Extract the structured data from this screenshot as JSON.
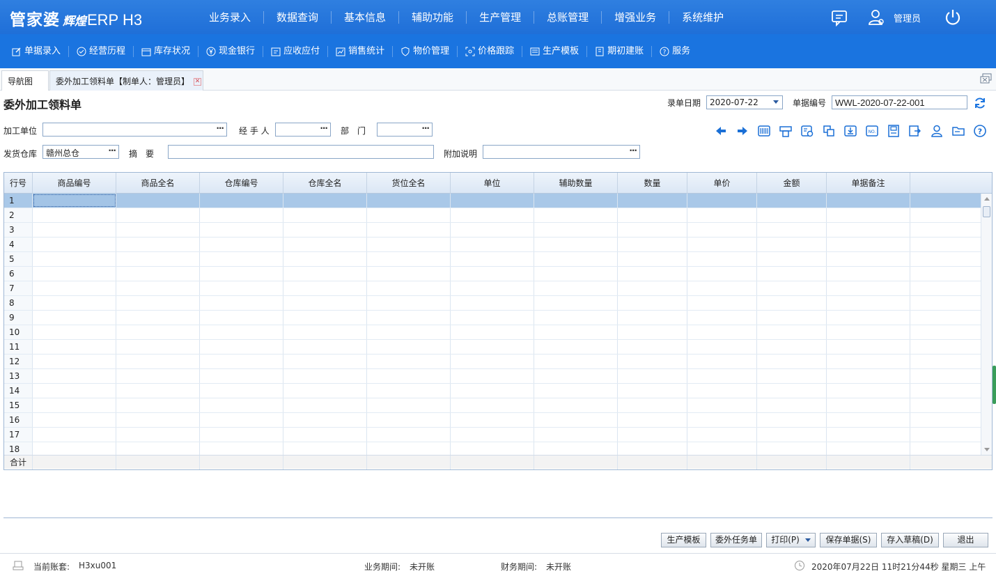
{
  "app": {
    "logo_main": "管家婆",
    "logo_sub": "辉煌",
    "logo_product": "ERP H3",
    "user": "管理员"
  },
  "main_nav": [
    "业务录入",
    "数据查询",
    "基本信息",
    "辅助功能",
    "生产管理",
    "总账管理",
    "增强业务",
    "系统维护"
  ],
  "sub_nav": [
    {
      "label": "单据录入",
      "icon": "edit-icon"
    },
    {
      "label": "经营历程",
      "icon": "check-circle-icon"
    },
    {
      "label": "库存状况",
      "icon": "box-icon"
    },
    {
      "label": "现金银行",
      "icon": "yuan-icon"
    },
    {
      "label": "应收应付",
      "icon": "ledger-icon"
    },
    {
      "label": "销售统计",
      "icon": "chart-icon"
    },
    {
      "label": "物价管理",
      "icon": "shield-icon"
    },
    {
      "label": "价格跟踪",
      "icon": "target-icon"
    },
    {
      "label": "生产模板",
      "icon": "template-icon"
    },
    {
      "label": "期初建账",
      "icon": "book-icon"
    },
    {
      "label": "服务",
      "icon": "help-icon"
    }
  ],
  "tabs": {
    "nav_tab": "导航图",
    "doc_tab": "委外加工领料单【制单人：管理员】"
  },
  "form": {
    "title": "委外加工领料单",
    "date_label": "录单日期",
    "date_value": "2020-07-22",
    "docno_label": "单据编号",
    "docno_value": "WWL-2020-07-22-001",
    "unit_label": "加工单位",
    "unit_value": "",
    "handler_label": "经 手 人",
    "handler_value": "",
    "dept_label": "部　门",
    "dept_value": "",
    "warehouse_label": "发货仓库",
    "warehouse_value": "赣州总仓",
    "summary_label": "摘　要",
    "summary_value": "",
    "note_label": "附加说明",
    "note_value": "",
    "dots": "···"
  },
  "grid": {
    "columns": [
      "行号",
      "商品编号",
      "商品全名",
      "仓库编号",
      "仓库全名",
      "货位全名",
      "单位",
      "辅助数量",
      "数量",
      "单价",
      "金额",
      "单据备注"
    ],
    "rows": [
      "1",
      "2",
      "3",
      "4",
      "5",
      "6",
      "7",
      "8",
      "9",
      "10",
      "11",
      "12",
      "13",
      "14",
      "15",
      "16",
      "17",
      "18"
    ],
    "total_label": "合计"
  },
  "buttons": {
    "template": "生产模板",
    "task": "委外任务单",
    "print": "打印(P)",
    "save": "保存单据(S)",
    "draft": "存入草稿(D)",
    "exit": "退出"
  },
  "status": {
    "account_label": "当前账套:",
    "account_value": "H3xu001",
    "biz_label": "业务期间:",
    "biz_value": "未开账",
    "fin_label": "财务期间:",
    "fin_value": "未开账",
    "datetime": "2020年07月22日 11时21分44秒 星期三 上午"
  },
  "colors": {
    "topbar": "#1f6fd8",
    "subbar": "#1a74e0",
    "selected_row": "#a9c8e8",
    "toolbar_icon": "#1a6fd6"
  }
}
